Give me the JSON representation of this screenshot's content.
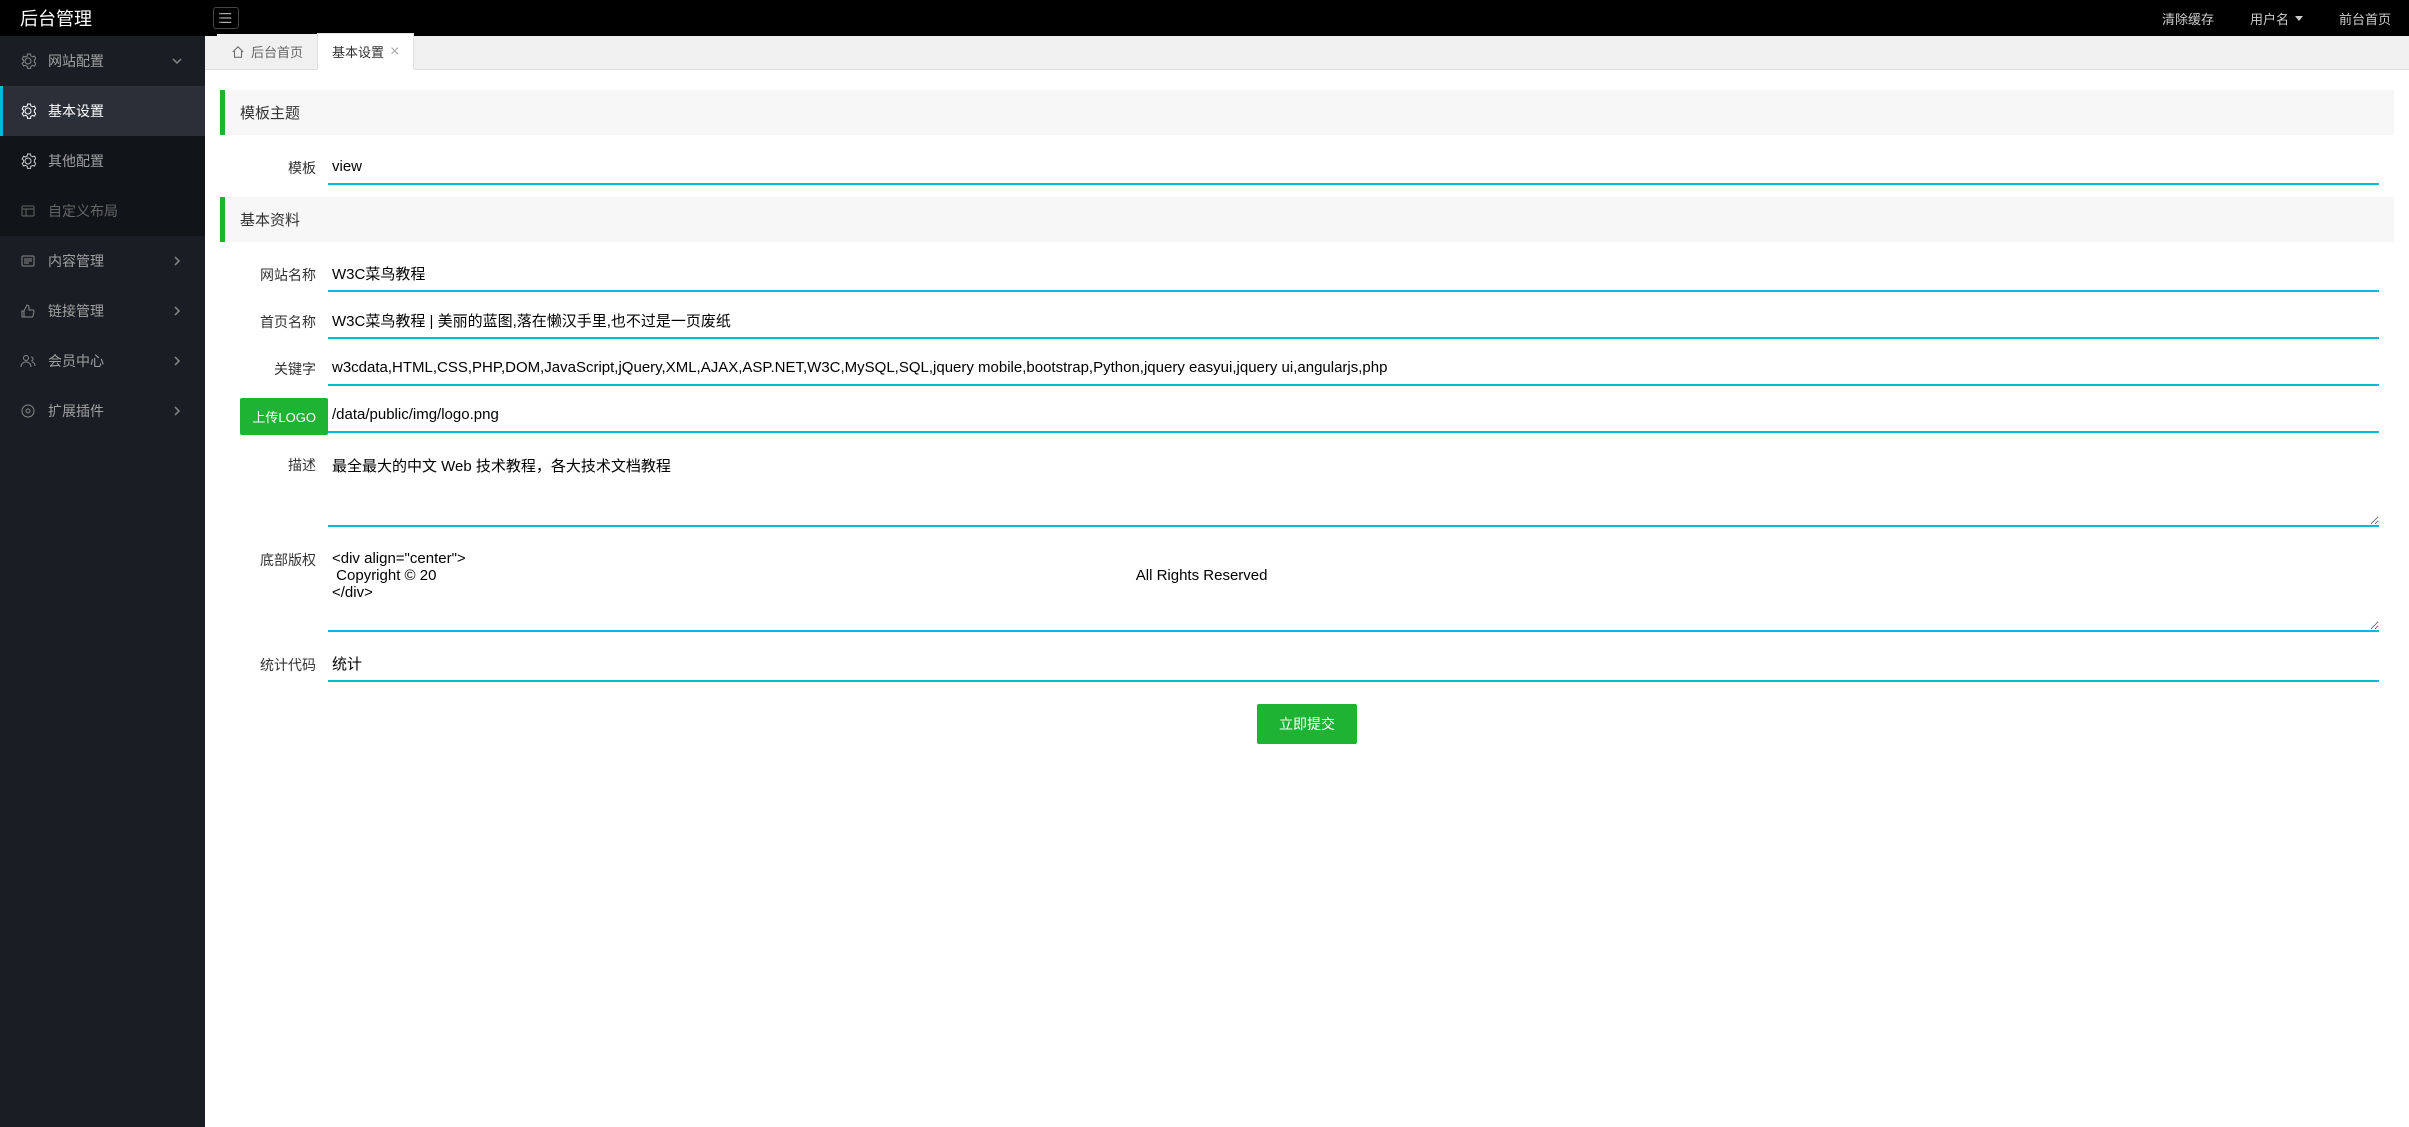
{
  "topbar": {
    "brand": "后台管理",
    "clear_cache": "清除缓存",
    "username": "用户名",
    "frontend": "前台首页"
  },
  "sidebar": {
    "items": [
      {
        "label": "网站配置",
        "hasSub": true,
        "expanded": true
      },
      {
        "label": "基本设置",
        "sub": true,
        "active": true
      },
      {
        "label": "其他配置",
        "sub": true
      },
      {
        "label": "自定义布局",
        "sub": true,
        "dim": true
      },
      {
        "label": "内容管理",
        "hasSub": true
      },
      {
        "label": "链接管理",
        "hasSub": true
      },
      {
        "label": "会员中心",
        "hasSub": true
      },
      {
        "label": "扩展插件",
        "hasSub": true
      }
    ]
  },
  "tabs": {
    "home": "后台首页",
    "current": "基本设置"
  },
  "sections": {
    "template_theme": "模板主题",
    "basic_info": "基本资料"
  },
  "form": {
    "template": {
      "label": "模板",
      "value": "view"
    },
    "site_name": {
      "label": "网站名称",
      "value": "W3C菜鸟教程"
    },
    "home_name": {
      "label": "首页名称",
      "value": "W3C菜鸟教程 | 美丽的蓝图,落在懒汉手里,也不过是一页废纸"
    },
    "keywords": {
      "label": "关键字",
      "value": "w3cdata,HTML,CSS,PHP,DOM,JavaScript,jQuery,XML,AJAX,ASP.NET,W3C,MySQL,SQL,jquery mobile,bootstrap,Python,jquery easyui,jquery ui,angularjs,php"
    },
    "logo": {
      "label": "上传LOGO",
      "value": "/data/public/img/logo.png"
    },
    "description": {
      "label": "描述",
      "value": "最全最大的中文 Web 技术教程，各大技术文档教程"
    },
    "footer": {
      "label": "底部版权",
      "value": "<div align=\"center\">\n Copyright © 20                                                                                                                                                                        All Rights Reserved\n</div>"
    },
    "stats": {
      "label": "统计代码",
      "value": "统计"
    }
  },
  "buttons": {
    "submit": "立即提交"
  }
}
